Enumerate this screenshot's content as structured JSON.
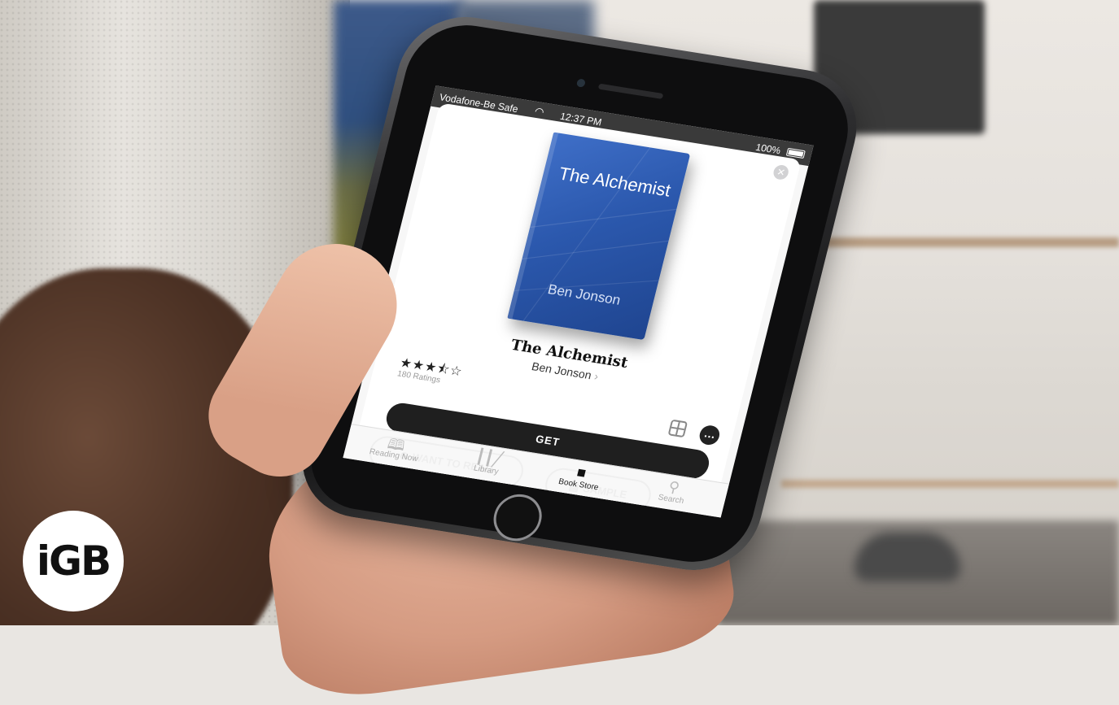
{
  "status_bar": {
    "carrier": "Vodafone-Be Safe",
    "time": "12:37 PM",
    "battery": "100%"
  },
  "book": {
    "cover_title": "The Alchemist",
    "cover_author": "Ben Jonson",
    "title": "The Alchemist",
    "author": "Ben Jonson",
    "rating_stars": 3.5,
    "stars_glyphs": "★★★⯪☆",
    "ratings_count": "180 Ratings"
  },
  "actions": {
    "get_label": "GET",
    "want_label": "WANT TO READ",
    "sample_label": "SAMPLE"
  },
  "tabs": [
    {
      "label": "Reading Now",
      "icon": "book-open-icon"
    },
    {
      "label": "Library",
      "icon": "library-icon"
    },
    {
      "label": "Book Store",
      "icon": "shopping-bag-icon"
    },
    {
      "label": "Search",
      "icon": "search-icon"
    }
  ],
  "brand": {
    "logo_text": "iGB"
  },
  "colors": {
    "cover": "#2b58ad",
    "button_dark": "#1f1f1f"
  }
}
